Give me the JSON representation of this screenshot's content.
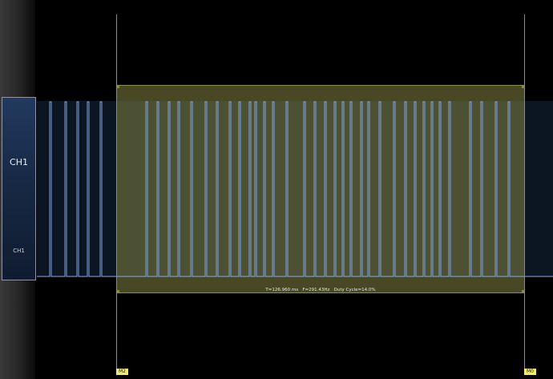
{
  "channel": {
    "name": "CH1",
    "name_small": "CH1"
  },
  "measurement": {
    "text": "T=126.960 ms   F=291.43Hz   Duty Cycle=14.0%"
  },
  "markers": {
    "left": "M2",
    "right": "M0"
  },
  "colors": {
    "background": "#000000",
    "trace": "#7fa3e0",
    "selection": "#848442",
    "marker_tag": "#f2ea6a"
  }
}
